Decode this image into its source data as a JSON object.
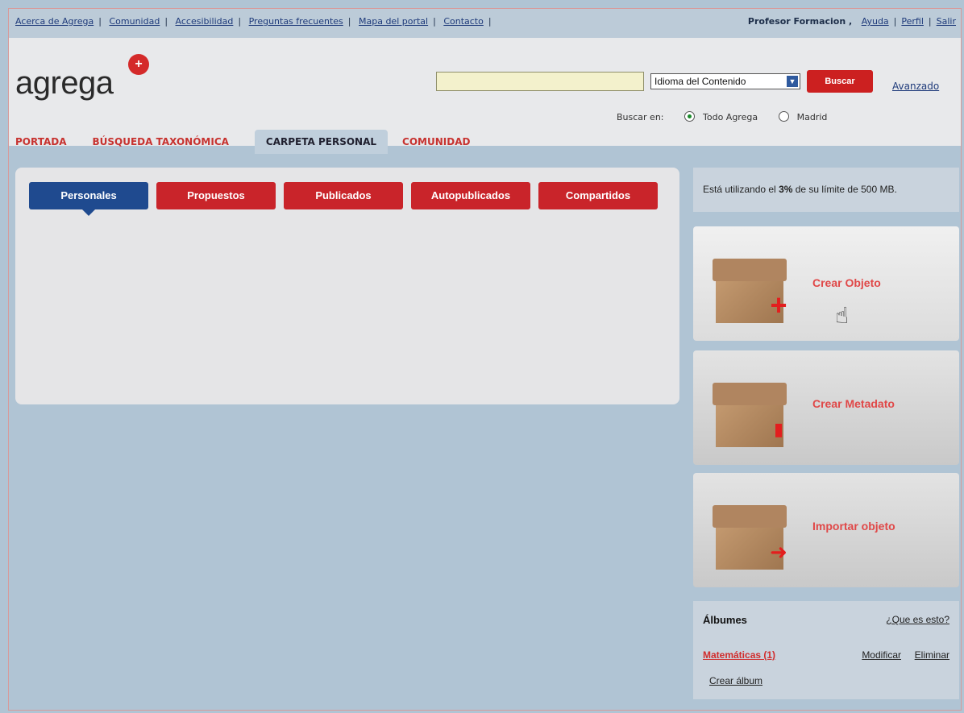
{
  "topbar": {
    "links": [
      "Acerca de Agrega",
      "Comunidad",
      "Accesibilidad",
      "Preguntas frecuentes",
      "Mapa del portal",
      "Contacto"
    ],
    "user": "Profesor Formacion ,",
    "help": "Ayuda",
    "profile": "Perfil",
    "logout": "Salir"
  },
  "logo": {
    "text": "agrega",
    "mark": "+"
  },
  "search": {
    "value": "",
    "language": "Idioma del Contenido",
    "button": "Buscar",
    "advanced": "Avanzado",
    "scope_label": "Buscar en:",
    "scope_options": [
      "Todo Agrega",
      "Madrid"
    ],
    "scope_selected": "Todo Agrega"
  },
  "nav": {
    "tabs": [
      "PORTADA",
      "BÚSQUEDA TAXONÓMICA",
      "CARPETA PERSONAL",
      "COMUNIDAD"
    ],
    "active": "CARPETA PERSONAL"
  },
  "folder": {
    "tabs": [
      "Personales",
      "Propuestos",
      "Publicados",
      "Autopublicados",
      "Compartidos"
    ],
    "active": "Personales"
  },
  "quota": {
    "prefix": "Está utilizando el ",
    "percent": "3%",
    "suffix": " de su límite de 500 MB."
  },
  "actions": [
    "Crear Objeto",
    "Crear Metadato",
    "Importar objeto"
  ],
  "albums": {
    "title": "Álbumes",
    "help": "¿Que es esto?",
    "items": [
      {
        "name": "Matemáticas (1)",
        "modify": "Modificar",
        "delete": "Eliminar"
      }
    ],
    "create": "Crear álbum"
  },
  "colors": {
    "accent_red": "#c9242a",
    "active_blue": "#1f4a8f",
    "background": "#b0c4d4"
  }
}
